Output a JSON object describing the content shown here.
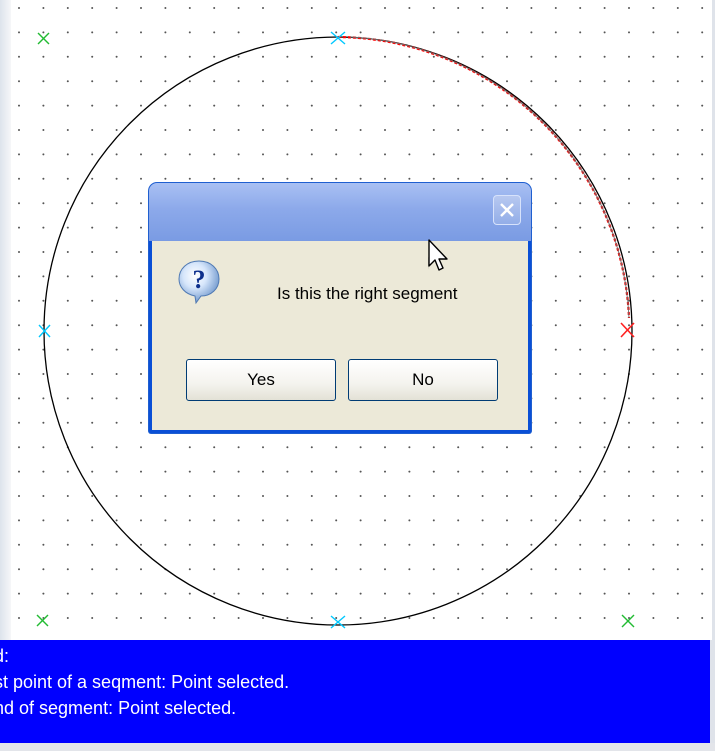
{
  "dialog": {
    "title": "",
    "message": "Is this the right segment",
    "yes_label": "Yes",
    "no_label": "No",
    "icon": "question-icon"
  },
  "console": {
    "lines": [
      "d:",
      "st point of a seqment: Point selected.",
      "nd of segment: Point selected."
    ],
    "background": "#0000ff",
    "text_color": "#ffffff"
  },
  "canvas": {
    "shape": "circle",
    "selected_segment_color": "#ff0000",
    "point_marker_colors": {
      "corner": "#22bb33",
      "quadrant": "#00c8ff",
      "selected": "#ff2020"
    }
  }
}
